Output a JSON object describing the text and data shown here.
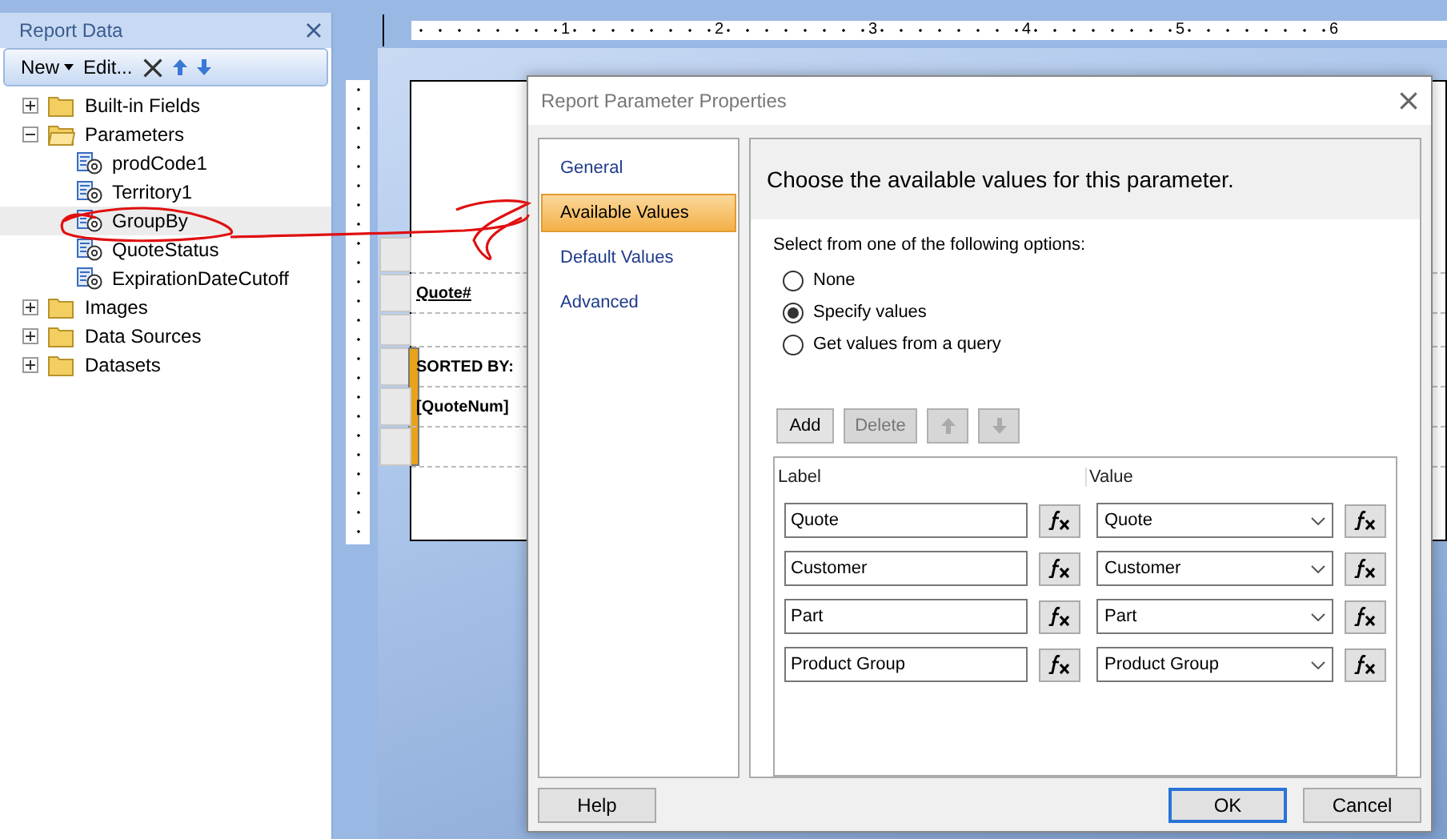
{
  "report_data": {
    "title": "Report Data",
    "toolbar": [
      {
        "kind": "menu",
        "label": "New"
      },
      {
        "kind": "text",
        "label": "Edit..."
      },
      {
        "kind": "delete"
      },
      {
        "kind": "up"
      },
      {
        "kind": "down"
      }
    ],
    "tree": [
      {
        "kind": "folder",
        "label": "Built-in Fields",
        "expanded": false
      },
      {
        "kind": "folder",
        "label": "Parameters",
        "expanded": true,
        "children": [
          {
            "kind": "parameter",
            "label": "prodCode1",
            "selected": false
          },
          {
            "kind": "parameter",
            "label": "Territory1",
            "selected": false
          },
          {
            "kind": "parameter",
            "label": "GroupBy",
            "selected": true
          },
          {
            "kind": "parameter",
            "label": "QuoteStatus",
            "selected": false
          },
          {
            "kind": "parameter",
            "label": "ExpirationDateCutoff",
            "selected": false
          }
        ]
      },
      {
        "kind": "folder",
        "label": "Images",
        "expanded": false
      },
      {
        "kind": "folder",
        "label": "Data Sources",
        "expanded": false
      },
      {
        "kind": "folder",
        "label": "Datasets",
        "expanded": false
      }
    ]
  },
  "ruler": {
    "marks": [
      "1",
      "2",
      "3",
      "4",
      "5",
      "6"
    ]
  },
  "report_page": {
    "header": "Quote#",
    "sort_label": "SORTED BY:",
    "sort_field": "[QuoteNum]"
  },
  "dialog": {
    "title": "Report Parameter Properties",
    "nav": [
      {
        "label": "General",
        "selected": false
      },
      {
        "label": "Available Values",
        "selected": true
      },
      {
        "label": "Default Values",
        "selected": false
      },
      {
        "label": "Advanced",
        "selected": false
      }
    ],
    "heading": "Choose the available values for this parameter.",
    "prompt": "Select from one of the following options:",
    "options": [
      {
        "label": "None",
        "selected": false
      },
      {
        "label": "Specify values",
        "selected": true
      },
      {
        "label": "Get values from a query",
        "selected": false
      }
    ],
    "toolbar": [
      {
        "kind": "text",
        "label": "Add",
        "disabled": false
      },
      {
        "kind": "text",
        "label": "Delete",
        "disabled": true
      },
      {
        "kind": "up",
        "disabled": true
      },
      {
        "kind": "down",
        "disabled": true
      }
    ],
    "columns": [
      "Label",
      "Value"
    ],
    "rows": [
      {
        "label": "Quote",
        "value": "Quote"
      },
      {
        "label": "Customer",
        "value": "Customer"
      },
      {
        "label": "Part",
        "value": "Part"
      },
      {
        "label": "Product Group",
        "value": "Product Group"
      }
    ],
    "help_button": {
      "label": "Help"
    },
    "buttons": [
      {
        "label": "OK",
        "default": true
      },
      {
        "label": "Cancel",
        "default": false
      }
    ]
  }
}
